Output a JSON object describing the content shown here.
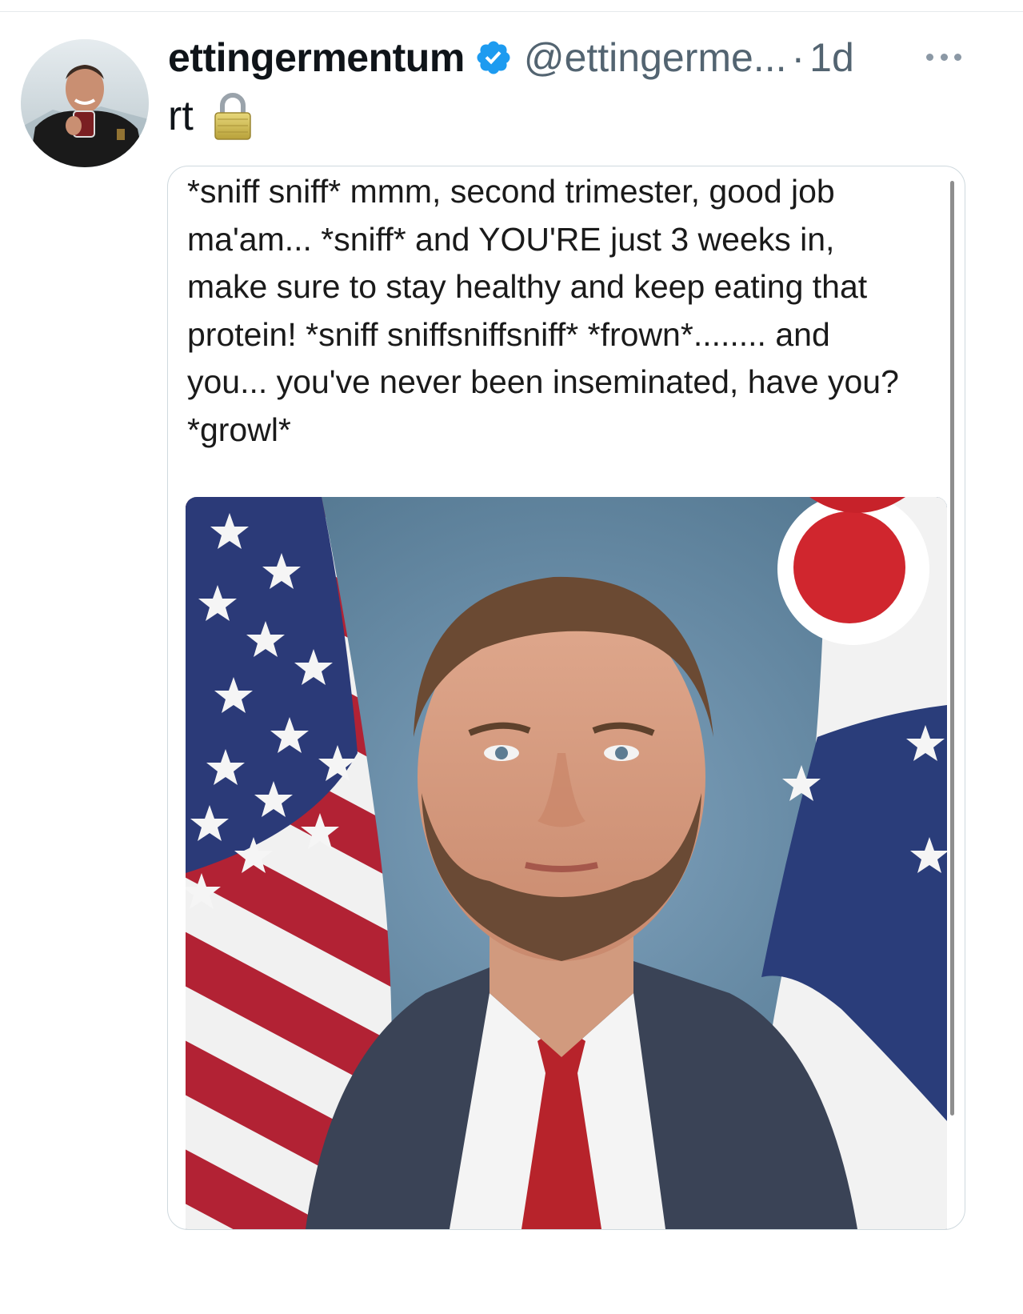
{
  "tweet": {
    "display_name": "ettingermentum",
    "handle": "@ettingerme...",
    "separator": "·",
    "timestamp": "1d",
    "text": "rt",
    "verified": true,
    "icons": {
      "verified": "verified-badge-icon",
      "lock": "lock-icon",
      "more": "more-options-icon"
    }
  },
  "quoted_post": {
    "lines": [
      "*sniff sniff* mmm, second trimester, good job",
      "ma'am... *sniff* and YOU'RE just 3 weeks in,",
      "make sure to stay healthy and keep eating that",
      "protein! *sniff sniffsniffsniff* *frown*........ and",
      "you... you've never been inseminated, have you?",
      "*growl*"
    ]
  },
  "colors": {
    "verified_blue": "#1d9bf0",
    "secondary_text": "#536471",
    "border": "#cfd9de"
  }
}
